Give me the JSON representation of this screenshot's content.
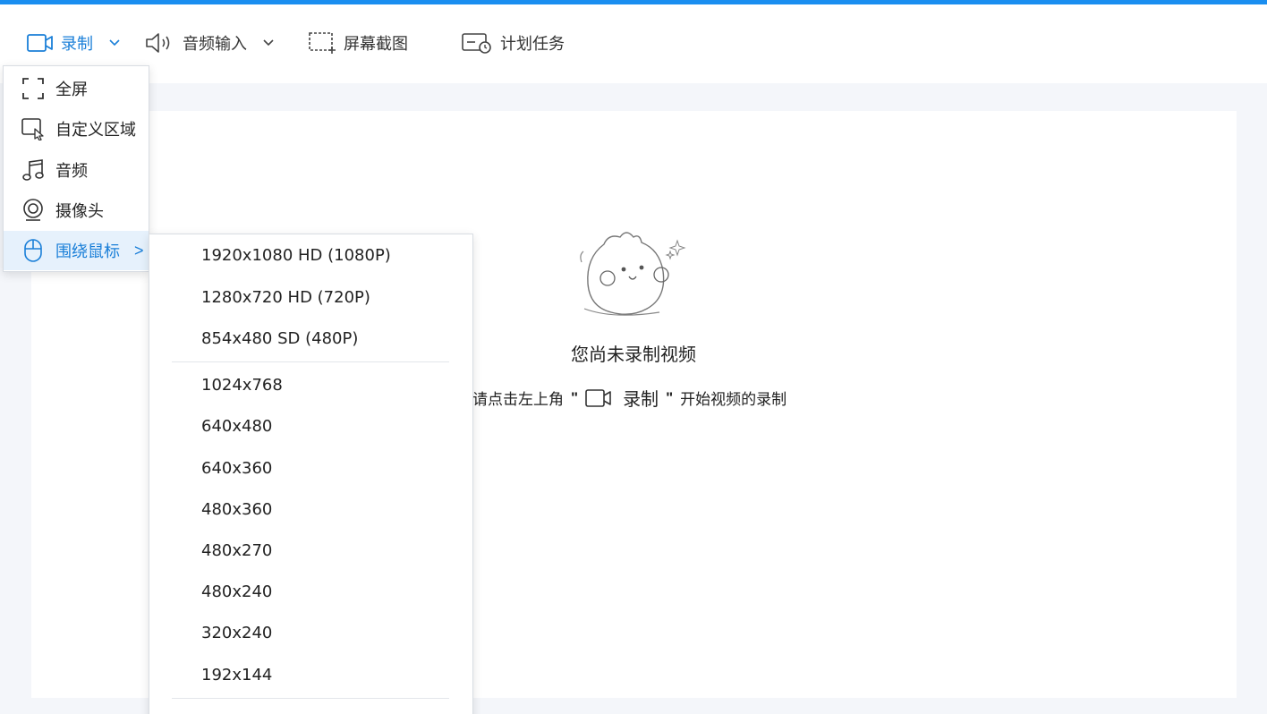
{
  "toolbar": {
    "record_label": "录制",
    "audio_label": "音频输入",
    "screenshot_label": "屏幕截图",
    "schedule_label": "计划任务"
  },
  "menu": {
    "items": [
      {
        "label": "全屏",
        "icon": "fullscreen-icon"
      },
      {
        "label": "自定义区域",
        "icon": "custom-area-icon"
      },
      {
        "label": "音频",
        "icon": "music-note-icon"
      },
      {
        "label": "摄像头",
        "icon": "webcam-icon"
      },
      {
        "label": "围绕鼠标",
        "icon": "mouse-icon"
      }
    ],
    "arrow": ">"
  },
  "submenu": {
    "group1": [
      "1920x1080 HD (1080P)",
      "1280x720 HD (720P)",
      "854x480 SD (480P)"
    ],
    "group2": [
      "1024x768",
      "640x480",
      "640x360",
      "480x360",
      "480x270",
      "480x240",
      "320x240",
      "192x144"
    ]
  },
  "empty": {
    "title": "您尚未录制视频",
    "hint_prefix": "请点击左上角",
    "quote_open": "\"",
    "record_word": "录制",
    "quote_close": "\"",
    "hint_suffix": "开始视频的录制"
  },
  "colors": {
    "accent": "#1a8ef0",
    "active_text": "#1a7fd8",
    "active_bg": "#e6f1fc"
  }
}
